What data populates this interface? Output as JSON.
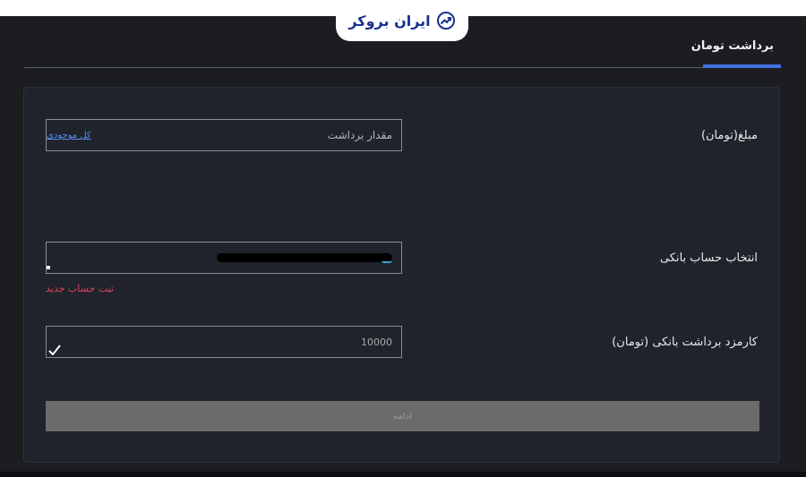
{
  "logo": {
    "text": "ایران بروکر",
    "icon": "trend-chart-icon",
    "color": "#1a2f8f"
  },
  "tab": {
    "title": "برداشت تومان",
    "accent": "#3f6fe0"
  },
  "form": {
    "amount": {
      "label": "مبلغ(تومان)",
      "placeholder": "مقدار برداشت",
      "all_balance_link": "کل موجودی"
    },
    "bank": {
      "label": "انتخاب حساب بانکی",
      "add_new_link": "ثبت حساب جدید"
    },
    "fee": {
      "label": "کارمزد برداشت بانکی (تومان)",
      "value": "10000"
    },
    "continue_label": "ادامه"
  },
  "colors": {
    "background": "#1b1d21",
    "card": "#20232b",
    "link": "#5a8ef5",
    "danger": "#e0445a"
  }
}
